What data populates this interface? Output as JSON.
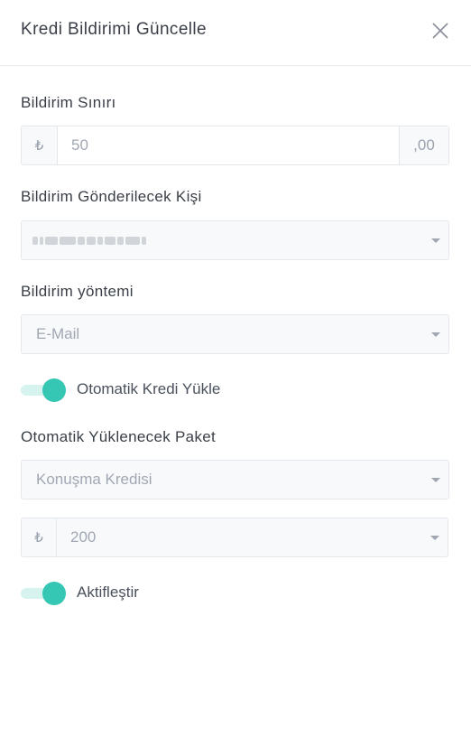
{
  "dialog": {
    "title": "Kredi Bildirimi Güncelle"
  },
  "notification_limit": {
    "label": "Bildirim Sınırı",
    "currency_symbol": "₺",
    "value": "50",
    "decimal_suffix": ",00"
  },
  "recipient": {
    "label": "Bildirim Gönderilecek Kişi"
  },
  "method": {
    "label": "Bildirim yöntemi",
    "selected": "E-Mail"
  },
  "auto_load_toggle": {
    "label": "Otomatik Kredi Yükle",
    "on": true
  },
  "auto_package": {
    "label": "Otomatik Yüklenecek Paket",
    "selected": "Konuşma Kredisi"
  },
  "amount": {
    "currency_symbol": "₺",
    "selected": "200"
  },
  "activate_toggle": {
    "label": "Aktifleştir",
    "on": true
  },
  "colors": {
    "accent": "#35c6b4",
    "accent_track": "#d6f3ef"
  }
}
